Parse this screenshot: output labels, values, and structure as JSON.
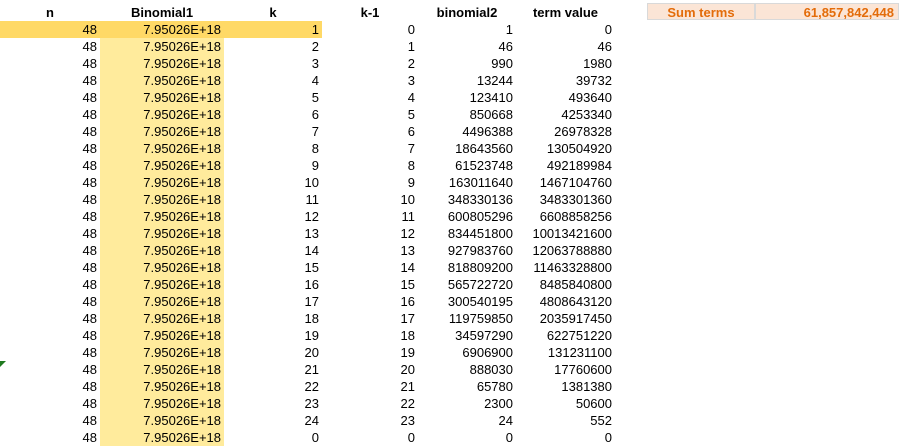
{
  "headers": [
    "n",
    "Binomial1",
    "k",
    "k-1",
    "binomial2",
    "term value"
  ],
  "summary": {
    "label": "Sum terms",
    "value": "61,857,842,448"
  },
  "rows": [
    [
      "48",
      "7.95026E+18",
      "1",
      "0",
      "1",
      "0"
    ],
    [
      "48",
      "7.95026E+18",
      "2",
      "1",
      "46",
      "46"
    ],
    [
      "48",
      "7.95026E+18",
      "3",
      "2",
      "990",
      "1980"
    ],
    [
      "48",
      "7.95026E+18",
      "4",
      "3",
      "13244",
      "39732"
    ],
    [
      "48",
      "7.95026E+18",
      "5",
      "4",
      "123410",
      "493640"
    ],
    [
      "48",
      "7.95026E+18",
      "6",
      "5",
      "850668",
      "4253340"
    ],
    [
      "48",
      "7.95026E+18",
      "7",
      "6",
      "4496388",
      "26978328"
    ],
    [
      "48",
      "7.95026E+18",
      "8",
      "7",
      "18643560",
      "130504920"
    ],
    [
      "48",
      "7.95026E+18",
      "9",
      "8",
      "61523748",
      "492189984"
    ],
    [
      "48",
      "7.95026E+18",
      "10",
      "9",
      "163011640",
      "1467104760"
    ],
    [
      "48",
      "7.95026E+18",
      "11",
      "10",
      "348330136",
      "3483301360"
    ],
    [
      "48",
      "7.95026E+18",
      "12",
      "11",
      "600805296",
      "6608858256"
    ],
    [
      "48",
      "7.95026E+18",
      "13",
      "12",
      "834451800",
      "10013421600"
    ],
    [
      "48",
      "7.95026E+18",
      "14",
      "13",
      "927983760",
      "12063788880"
    ],
    [
      "48",
      "7.95026E+18",
      "15",
      "14",
      "818809200",
      "11463328800"
    ],
    [
      "48",
      "7.95026E+18",
      "16",
      "15",
      "565722720",
      "8485840800"
    ],
    [
      "48",
      "7.95026E+18",
      "17",
      "16",
      "300540195",
      "4808643120"
    ],
    [
      "48",
      "7.95026E+18",
      "18",
      "17",
      "119759850",
      "2035917450"
    ],
    [
      "48",
      "7.95026E+18",
      "19",
      "18",
      "34597290",
      "622751220"
    ],
    [
      "48",
      "7.95026E+18",
      "20",
      "19",
      "6906900",
      "131231100"
    ],
    [
      "48",
      "7.95026E+18",
      "21",
      "20",
      "888030",
      "17760600"
    ],
    [
      "48",
      "7.95026E+18",
      "22",
      "21",
      "65780",
      "1381380"
    ],
    [
      "48",
      "7.95026E+18",
      "23",
      "22",
      "2300",
      "50600"
    ],
    [
      "48",
      "7.95026E+18",
      "24",
      "23",
      "24",
      "552"
    ],
    [
      "48",
      "7.95026E+18",
      "0",
      "0",
      "0",
      "0"
    ]
  ]
}
